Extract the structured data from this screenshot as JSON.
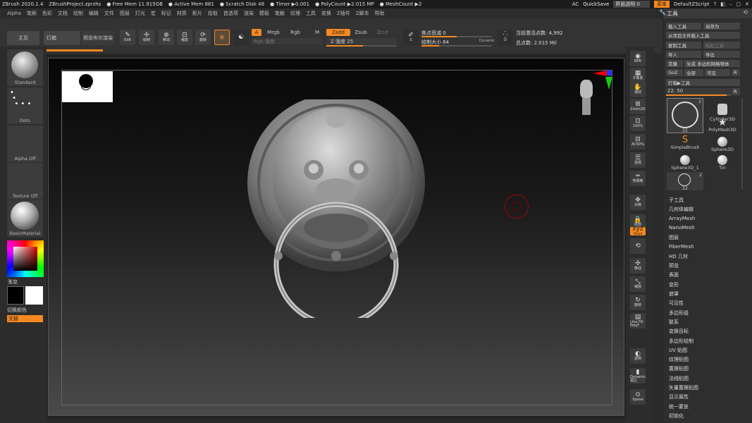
{
  "titlebar": {
    "items": [
      "ZBrush 2020.1.4",
      "ZBrushProject.zprzhs",
      "● Free Mem 11.915GB",
      "● Active Mem 881",
      "● Scratch Disk 48",
      "● Timer ▶0.001",
      "● PolyCount ▶2.015 MP",
      "● MeshCount ▶2"
    ],
    "right": {
      "ac": "AC",
      "quicksave": "QuickSave",
      "transparency": "界面透明 0",
      "menu": "菜单",
      "script": "DefaultZScript"
    }
  },
  "menu": [
    "Alpha",
    "笔刷",
    "色彩",
    "文档",
    "绘制",
    "编辑",
    "文件",
    "图层",
    "灯光",
    "宏",
    "标记",
    "材质",
    "影片",
    "拾取",
    "首选项",
    "渲染",
    "模板",
    "笔触",
    "纹理",
    "工具",
    "变换",
    "Z插件",
    "Z脚本",
    "帮助"
  ],
  "toolbar": {
    "home": "主页",
    "lightbox": "灯箱",
    "preview": "预览布尔渲染",
    "edit": "Edit",
    "draw": "绘制",
    "move": "移动",
    "scale": "缩放",
    "rotate": "旋转",
    "a": "A",
    "mrgb": "Mrgb",
    "rgb": "Rgb",
    "m": "M",
    "rgb_intensity": "Rgb 强度",
    "zadd": "Zadd",
    "zsub": "Zsub",
    "zcut": "Zcut",
    "z_intensity": "Z 强度 25",
    "focal": "焦点衰减 0",
    "draw_size": "绘制大小 64",
    "dynamic": "Dynamic",
    "active_points": "当前激活点数: 4,992",
    "total_points": "总点数: 2.015 Mil",
    "s_key": "S",
    "d_key": "D"
  },
  "left": {
    "standard": "Standard",
    "dots": "Dots",
    "alpha_off": "Alpha Off",
    "texture_off": "Texture Off",
    "basic_material": "BasicMaterial",
    "gradient": "渐变",
    "switch_color": "切换颜色",
    "alternate": "交替"
  },
  "right_tray": [
    {
      "g": "◉",
      "l": "BPR"
    },
    {
      "g": "▦",
      "l": "子像素"
    },
    {
      "g": "✋",
      "l": "滚动"
    },
    {
      "g": "⊞",
      "l": "Zoom2D"
    },
    {
      "g": "⊡",
      "l": "100%"
    },
    {
      "g": "⊟",
      "l": "AC50%"
    },
    {
      "g": "☰",
      "l": "透视"
    },
    {
      "g": "═",
      "l": "地网格"
    },
    {
      "g": "✥",
      "l": "对称"
    },
    {
      "g": "🔒",
      "l": "局部"
    },
    {
      "g": "xyz",
      "l": "Qxyz"
    },
    {
      "g": "⟲",
      "l": ""
    },
    {
      "g": "✣",
      "l": "移动"
    },
    {
      "g": "⤡",
      "l": "缩放"
    },
    {
      "g": "↻",
      "l": "旋转"
    },
    {
      "g": "▤",
      "l": "Line Fill PolyF"
    },
    {
      "g": "◐",
      "l": "透明"
    },
    {
      "g": "▮",
      "l": "Dynamic 孤立"
    },
    {
      "g": "⊙",
      "l": "Xpose"
    }
  ],
  "tool": {
    "title": "工具",
    "load": "载入工具",
    "save_as": "另存为",
    "load_from_project": "从项目文件载入工具",
    "copy": "复制工具",
    "paste": "粘贴工具",
    "import": "导入",
    "export": "导出",
    "clone": "克隆",
    "make_polymesh": "生成 多边形网格物体",
    "goz": "GoZ",
    "all": "全部",
    "visible": "可见",
    "r": "R",
    "lightbox_tools": "灯箱▶工具",
    "value": "22. 50",
    "thumbs": [
      "22",
      "Cylinder3D",
      "PolyMesh3D",
      "SimpleBrush",
      "Sphere3D",
      "Sphere3D_1",
      "Tin",
      "22"
    ],
    "thumb_counts": [
      "2",
      "2"
    ],
    "subpalettes": [
      "子工具",
      "几何体编辑",
      "ArrayMesh",
      "NanoMesh",
      "图层",
      "FiberMesh",
      "HD 几何",
      "预览",
      "表面",
      "变形",
      "遮罩",
      "可见性",
      "多边形组",
      "联系",
      "变换目标",
      "多边形绘制",
      "UV 贴图",
      "纹理贴图",
      "置换贴图",
      "法线贴图",
      "矢量置换贴图",
      "显示属性",
      "统一蒙皮",
      "初始化"
    ]
  }
}
